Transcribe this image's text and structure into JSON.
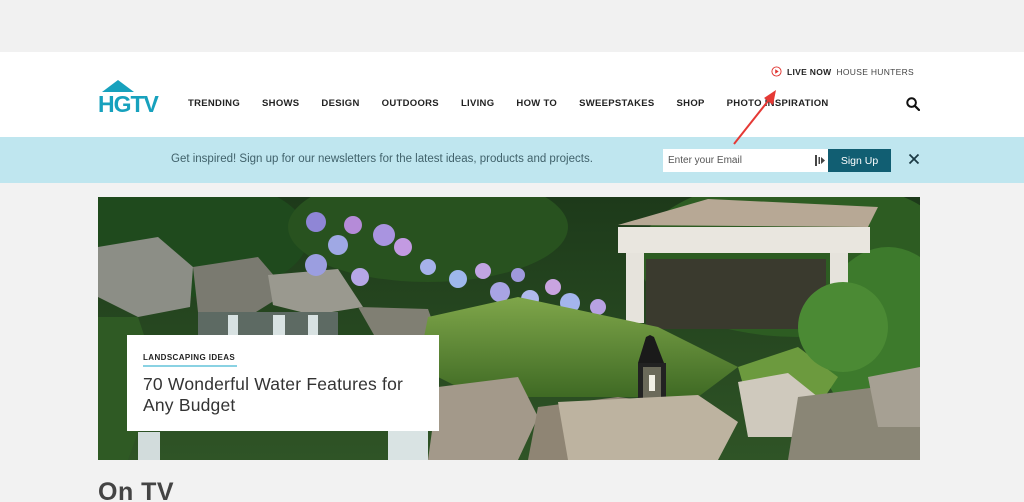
{
  "header": {
    "logo_text": "HGTV",
    "live_now": {
      "label": "LIVE NOW",
      "show": "HOUSE HUNTERS"
    },
    "nav": [
      {
        "label": "TRENDING"
      },
      {
        "label": "SHOWS"
      },
      {
        "label": "DESIGN"
      },
      {
        "label": "OUTDOORS"
      },
      {
        "label": "LIVING"
      },
      {
        "label": "HOW TO"
      },
      {
        "label": "SWEEPSTAKES"
      },
      {
        "label": "SHOP"
      },
      {
        "label": "PHOTO INSPIRATION"
      }
    ],
    "search_icon": "search-icon"
  },
  "newsletter": {
    "text": "Get inspired! Sign up for our newsletters for the latest ideas, products and projects.",
    "email_placeholder": "Enter your Email",
    "signup_label": "Sign Up",
    "close_icon": "close-icon"
  },
  "hero": {
    "kicker": "LANDSCAPING IDEAS",
    "title": "70 Wonderful Water Features for Any Budget"
  },
  "section": {
    "heading": "On TV"
  },
  "colors": {
    "brand": "#17a1bd",
    "newsletter_bg": "#bfe6ef",
    "signup_button": "#115e72",
    "annotation_arrow": "#e53935"
  }
}
